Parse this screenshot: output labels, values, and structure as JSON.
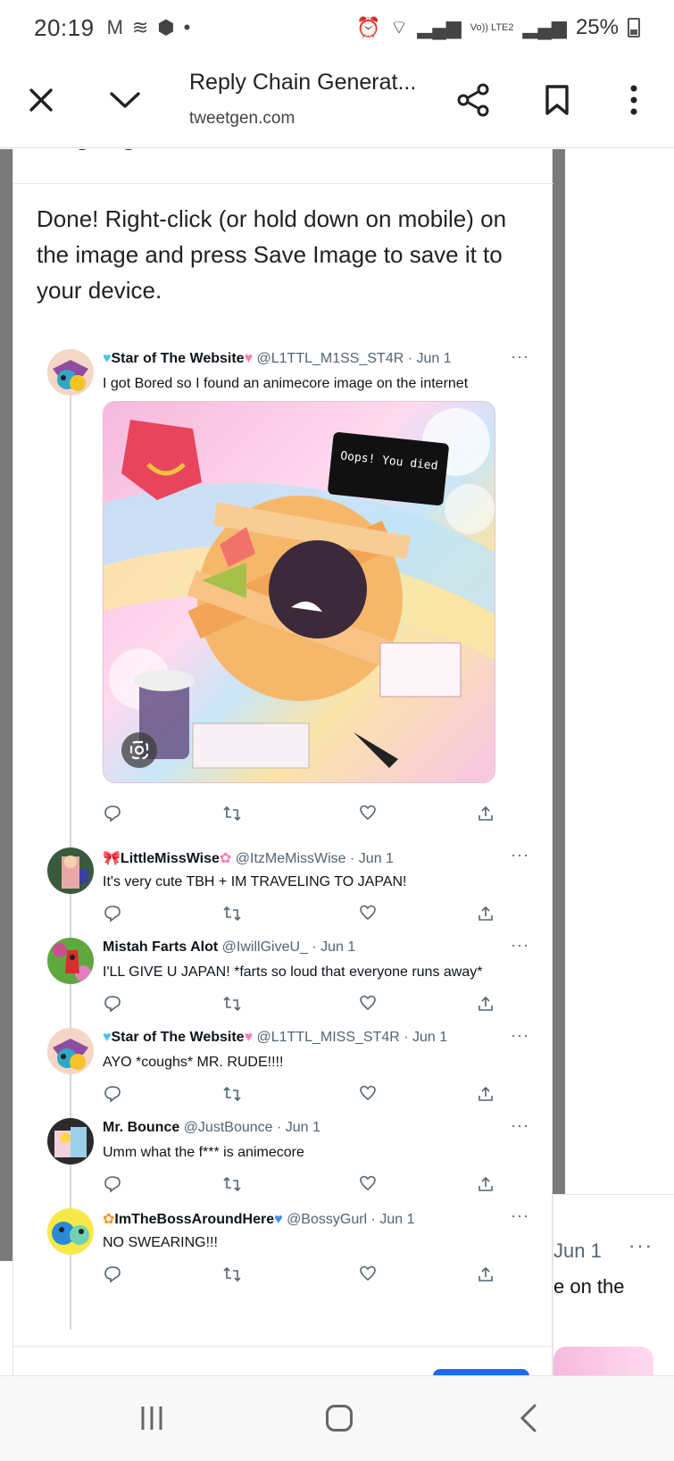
{
  "status_bar": {
    "time": "20:19",
    "left_icons": [
      "gmail-icon",
      "signal-app-icon",
      "shield-app-icon",
      "dot-icon"
    ],
    "right_text": "Vo)) LTE2",
    "battery": "25%"
  },
  "browser": {
    "title": "Reply Chain Generat...",
    "url": "tweetgen.com"
  },
  "content": {
    "done_message": "Done! Right-click (or hold down on mobile) on the image and press Save Image to save it to your device."
  },
  "media": {
    "oops_text": "Oops! You died"
  },
  "tweets": [
    {
      "name": "Star of The Website",
      "handle": "@L1TTL_M1SS_ST4R",
      "date": "Jun 1",
      "text": "I got Bored so I found an animecore image on the internet",
      "prefix_emoji": "♥",
      "suffix_emoji": "♥"
    },
    {
      "name": "LittleMissWise",
      "handle": "@ItzMeMissWise",
      "date": "Jun 1",
      "text": "It's very cute TBH + IM TRAVELING TO JAPAN!",
      "prefix_emoji": "🎀",
      "suffix_emoji": "✿"
    },
    {
      "name": "Mistah Farts Alot",
      "handle": "@IwillGiveU_",
      "date": "Jun 1",
      "text": "I'LL GIVE U JAPAN! *farts so loud that everyone runs away*",
      "prefix_emoji": "",
      "suffix_emoji": ""
    },
    {
      "name": "Star of The Website",
      "handle": "@L1TTL_MISS_ST4R",
      "date": "Jun 1",
      "text": "AYO *coughs* MR. RUDE!!!!",
      "prefix_emoji": "♥",
      "suffix_emoji": "♥"
    },
    {
      "name": "Mr. Bounce",
      "handle": "@JustBounce",
      "date": "Jun 1",
      "text": "Umm what the f*** is animecore",
      "prefix_emoji": "",
      "suffix_emoji": ""
    },
    {
      "name": "ImTheBossAroundHere",
      "handle": "@BossyGurl",
      "date": "Jun 1",
      "text": "NO SWEARING!!!",
      "prefix_emoji": "✿",
      "suffix_emoji": "♥"
    }
  ],
  "more_label": "···",
  "peek": {
    "date": "Jun 1",
    "more": "···",
    "text": "e on the"
  },
  "colors": {
    "accent_blue": "#1d6bf0",
    "secondary_text": "#536471",
    "thread_line": "#cfd9de"
  }
}
